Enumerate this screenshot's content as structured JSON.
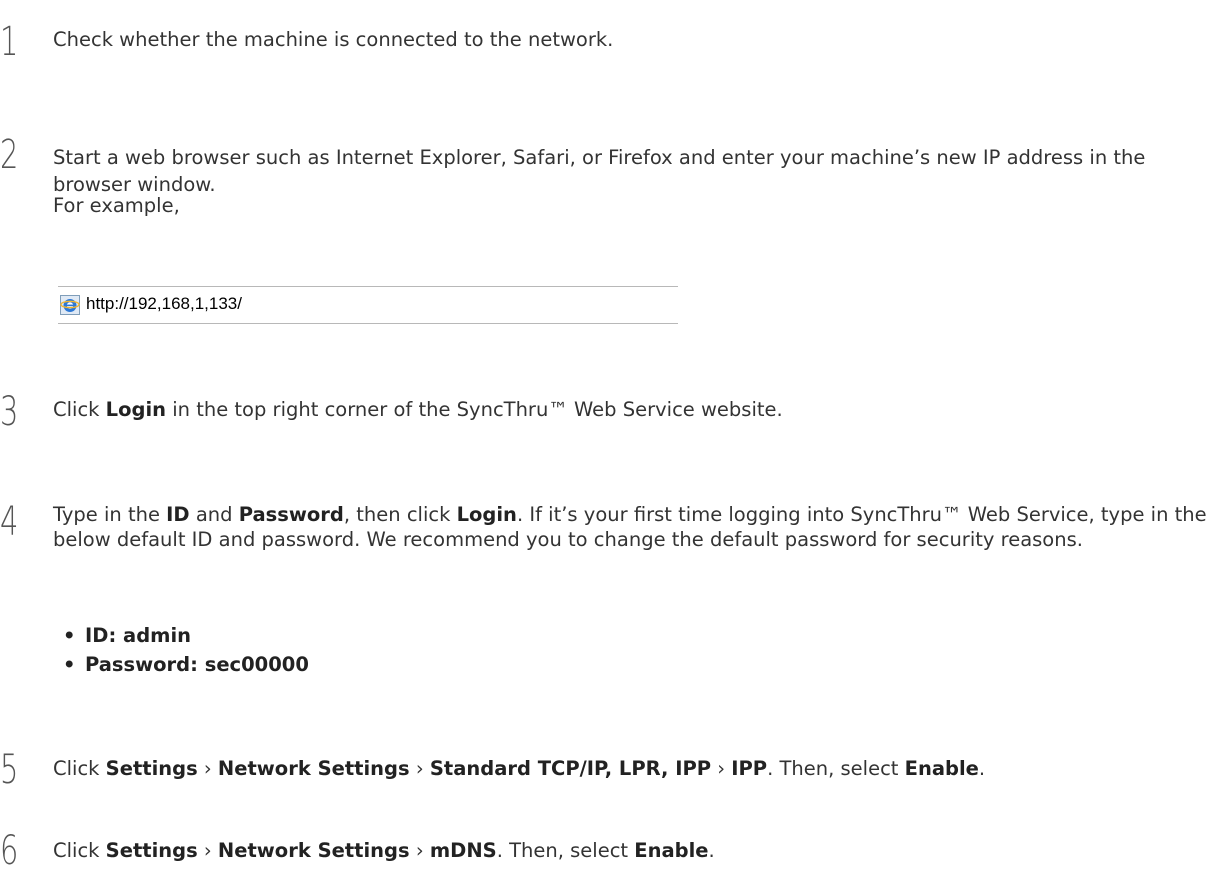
{
  "steps": [
    {
      "number": "1",
      "text": "Check whether the machine is connected to the network."
    },
    {
      "number": "2",
      "text": "Start a web browser such as Internet Explorer, Safari, or Firefox and enter your machine’s new IP address in the browser window.",
      "example_label": "For example,",
      "address_bar": {
        "url": "http://192,168,1,133/",
        "icon": "internet-explorer-icon"
      }
    },
    {
      "number": "3",
      "parts": [
        "Click ",
        "Login",
        " in the top right corner of the SyncThru™ Web Service website."
      ]
    },
    {
      "number": "4",
      "parts": [
        "Type in the ",
        "ID",
        " and ",
        "Password",
        ", then click ",
        "Login",
        ". If it’s your first time logging into SyncThru™ Web Service, type in the below default ID and password. We recommend you to change the default password for security reasons."
      ],
      "bullets": [
        "ID: admin",
        "Password: sec00000"
      ],
      "bullet_glyph": "•"
    },
    {
      "number": "5",
      "parts": [
        "Click ",
        "Settings",
        " › ",
        "Network Settings",
        " › ",
        "Standard TCP/IP, LPR, IPP",
        " › ",
        "IPP",
        ". Then, select ",
        "Enable",
        "."
      ]
    },
    {
      "number": "6",
      "parts": [
        "Click ",
        "Settings",
        " › ",
        "Network Settings",
        " › ",
        "mDNS",
        ". Then, select ",
        "Enable",
        "."
      ]
    }
  ]
}
